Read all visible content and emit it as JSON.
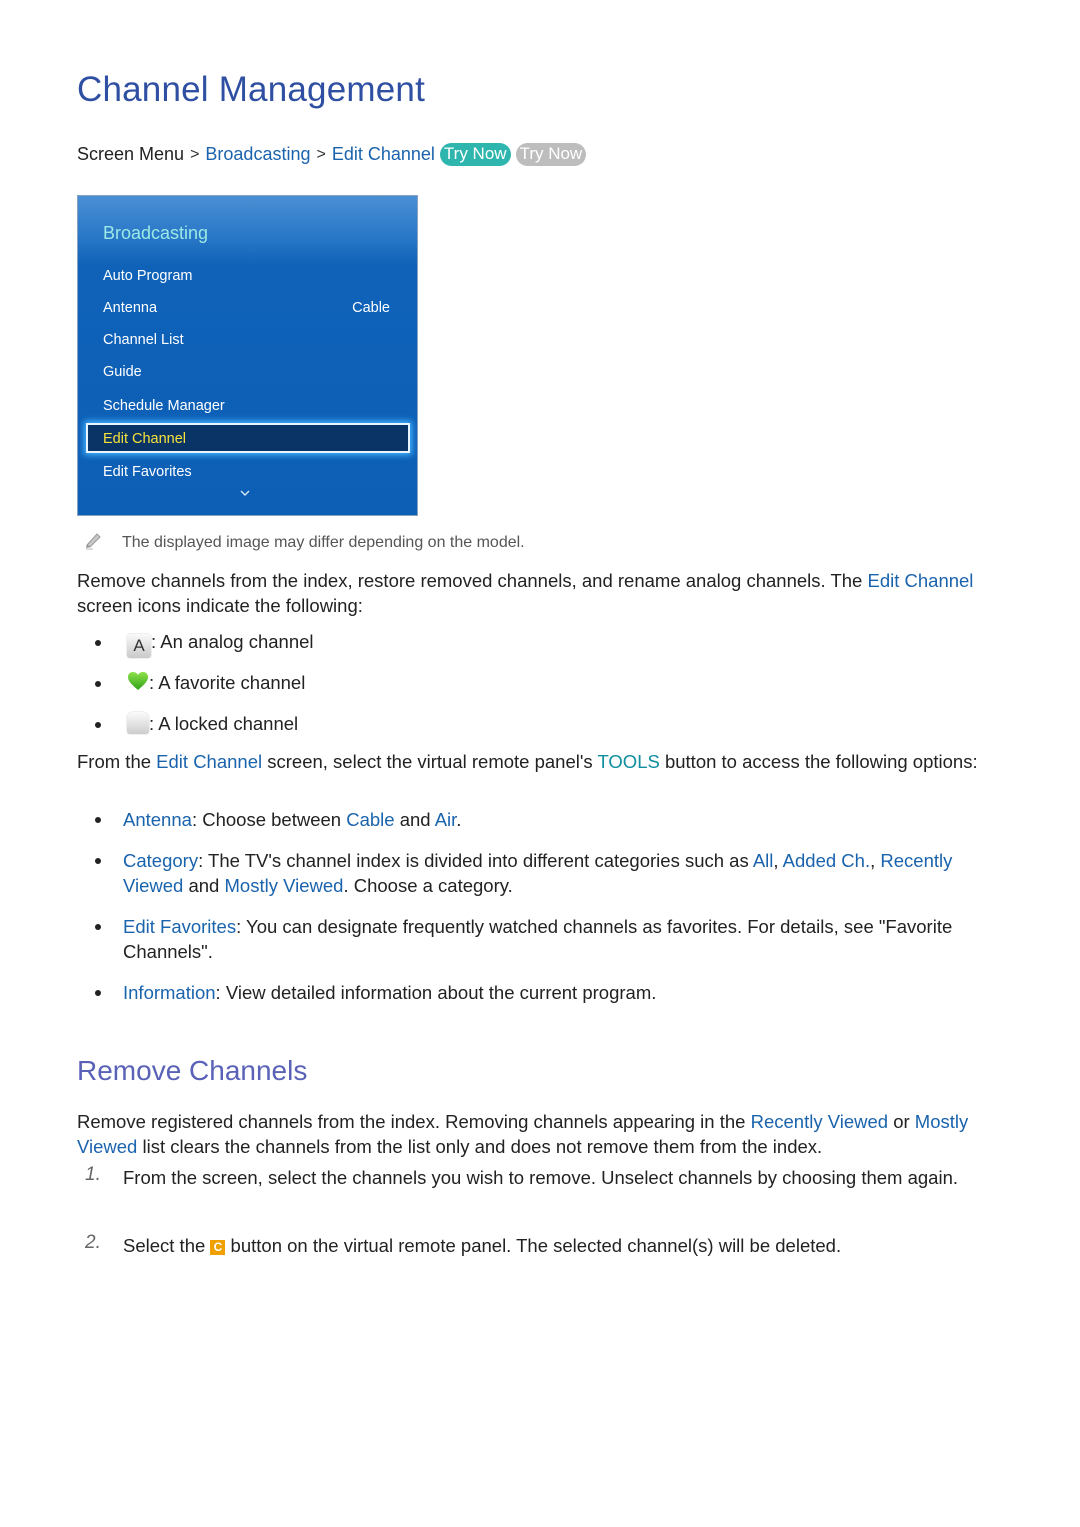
{
  "page": {
    "title": "Channel Management",
    "breadcrumb": {
      "root": "Screen Menu",
      "level1": "Broadcasting",
      "level2": "Edit Channel",
      "try_now_active": "Try Now",
      "try_now_inactive": "Try Now"
    },
    "panel": {
      "title": "Broadcasting",
      "items": [
        {
          "label": "Auto Program",
          "value": ""
        },
        {
          "label": "Antenna",
          "value": "Cable"
        },
        {
          "label": "Channel List",
          "value": ""
        },
        {
          "label": "Guide",
          "value": ""
        },
        {
          "label": "Schedule Manager",
          "value": ""
        },
        {
          "label": "Edit Channel",
          "value": "",
          "selected": true
        },
        {
          "label": "Edit Favorites",
          "value": ""
        }
      ],
      "more_icon": "chevron-down-icon"
    },
    "note": "The displayed image may differ depending on the model.",
    "intro": {
      "text1": "Remove channels from the index, restore removed channels, and rename analog channels. The ",
      "link": "Edit Channel",
      "text2": " screen icons indicate the following:"
    },
    "icons_list": [
      {
        "icon": "analog-icon",
        "glyph": "A",
        "text": ": An analog channel"
      },
      {
        "icon": "heart-icon",
        "glyph": "♥",
        "text": ": A favorite channel"
      },
      {
        "icon": "lock-icon",
        "glyph": "",
        "text": ": A locked channel"
      }
    ],
    "tools": {
      "text1": "From the ",
      "link1": "Edit Channel",
      "text2": " screen, select the virtual remote panel's ",
      "link2": "TOOLS",
      "text3": " button to access the following options:"
    },
    "options": {
      "antenna": {
        "term": "Antenna",
        "text1": ": Choose between ",
        "cable": "Cable",
        "text2": " and ",
        "air": "Air",
        "text3": "."
      },
      "category": {
        "term": "Category",
        "text1": ": The TV's channel index is divided into different categories such as ",
        "all": "All",
        "comma": ", ",
        "added": "Added Ch.",
        "text2": ", ",
        "recent": "Recently Viewed",
        "and": " and ",
        "mostly": "Mostly Viewed",
        "text3": ". Choose a category."
      },
      "favorites": {
        "term": "Edit Favorites",
        "text1": ": You can designate frequently watched channels as favorites. For details, see \"Favorite Channels\"."
      },
      "information": {
        "term": "Information",
        "text1": ": View detailed information about the current program."
      }
    },
    "remove": {
      "heading": "Remove Channels",
      "text1": "Remove registered channels from the index. Removing channels appearing in the ",
      "link1": "Recently Viewed",
      "text2": " or ",
      "link2": "Mostly Viewed",
      "text3": " list clears the channels from the list only and does not remove them from the index.",
      "steps": [
        {
          "num": "1.",
          "text": "From the screen, select the channels you wish to remove. Unselect channels by choosing them again."
        },
        {
          "num": "2.",
          "text1": "Select the ",
          "button": "C",
          "text2": " button on the virtual remote panel. The selected channel(s) will be deleted."
        }
      ]
    }
  }
}
